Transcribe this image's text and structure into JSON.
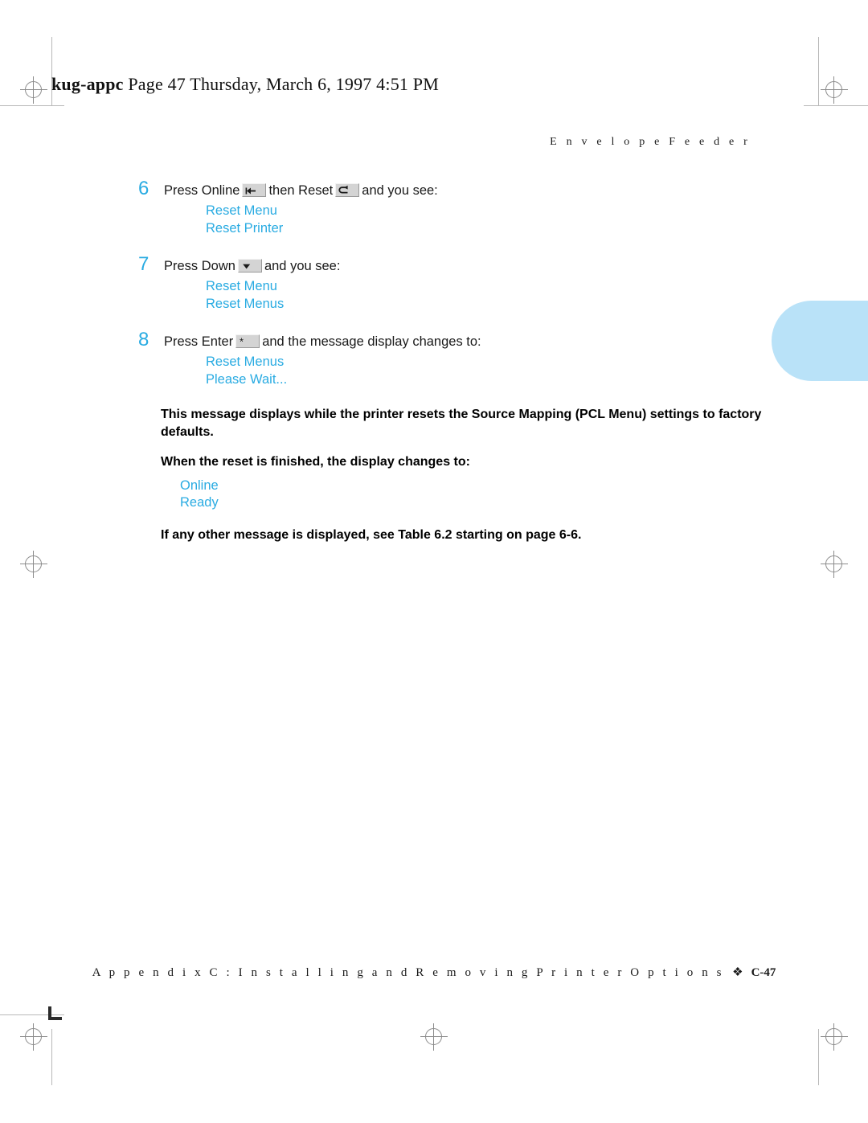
{
  "file_banner": {
    "filename": "kug-appc",
    "rest": " Page 47  Thursday, March 6, 1997  4:51 PM"
  },
  "running_head": "E n v e l o p e   F e e d e r",
  "steps": [
    {
      "number": "6",
      "text_before": "Press Online",
      "icon1_name": "online-key-icon",
      "text_middle": "then Reset",
      "icon2_name": "reset-return-key-icon",
      "text_after": "and you see:",
      "display": [
        "Reset Menu",
        "Reset Printer"
      ]
    },
    {
      "number": "7",
      "text_before": "Press Down",
      "icon1_name": "down-arrow-key-icon",
      "text_after": "and you see:",
      "display": [
        "Reset Menu",
        "Reset Menus"
      ]
    },
    {
      "number": "8",
      "text_before": "Press Enter",
      "icon1_name": "enter-asterisk-key-icon",
      "text_after": "and the message display changes to:",
      "display": [
        "Reset Menus",
        "Please Wait..."
      ]
    }
  ],
  "notes": {
    "reset_description": "This message displays while the printer resets the Source Mapping (PCL Menu) settings to factory defaults.",
    "finished_lead_in": "When the reset is finished, the display changes to:",
    "final_display": [
      "Online",
      "Ready"
    ],
    "other_message": "If any other message is displayed, see Table 6.2 starting on page 6-6."
  },
  "footer": {
    "chapter": "A p p e n d i x   C :   I n s t a l l i n g   a n d   R e m o v i n g   P r i n t e r   O p t i o n s",
    "separator": "❖",
    "page_number": "C-47"
  },
  "colors": {
    "accent_cyan": "#29abe2",
    "thumb_tab": "#b9e2f8",
    "body_text": "#1a1a1a",
    "keycap_face": "#d4d4d4"
  }
}
